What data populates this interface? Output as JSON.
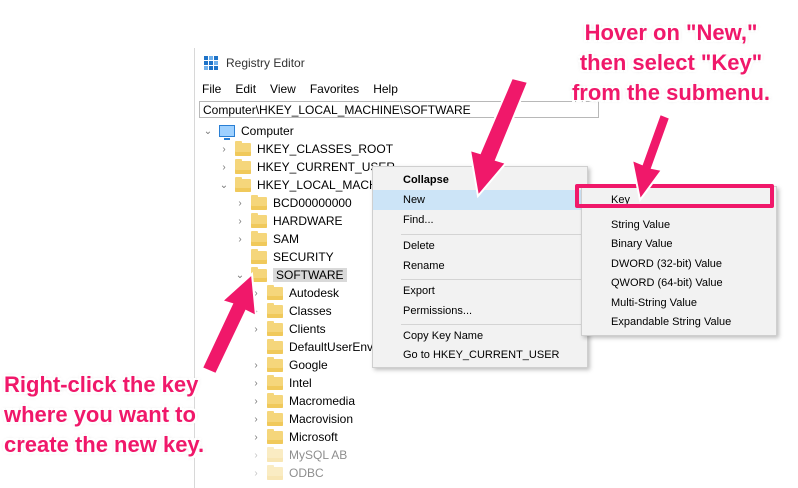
{
  "window": {
    "title": "Registry Editor",
    "menu": [
      "File",
      "Edit",
      "View",
      "Favorites",
      "Help"
    ],
    "address": "Computer\\HKEY_LOCAL_MACHINE\\SOFTWARE"
  },
  "tree": {
    "root": "Computer",
    "hives": [
      "HKEY_CLASSES_ROOT",
      "HKEY_CURRENT_USER",
      "HKEY_LOCAL_MACHIN"
    ],
    "hklm_children": [
      "BCD00000000",
      "HARDWARE",
      "SAM",
      "SECURITY",
      "SOFTWARE"
    ],
    "software_children": [
      "Autodesk",
      "Classes",
      "Clients",
      "DefaultUserEnvir",
      "Google",
      "Intel",
      "Macromedia",
      "Macrovision",
      "Microsoft",
      "MySQL AB",
      "ODBC"
    ]
  },
  "context_menu": {
    "collapse": "Collapse",
    "new": "New",
    "find": "Find...",
    "delete": "Delete",
    "rename": "Rename",
    "export": "Export",
    "permissions": "Permissions...",
    "copy_key_name": "Copy Key Name",
    "goto": "Go to HKEY_CURRENT_USER"
  },
  "submenu": {
    "key": "Key",
    "string_value": "String Value",
    "binary_value": "Binary Value",
    "dword_value": "DWORD (32-bit) Value",
    "qword_value": "QWORD (64-bit) Value",
    "multi_string_value": "Multi-String Value",
    "expandable_string_value": "Expandable String Value"
  },
  "annotations": {
    "top_line1": "Hover on \"New,\"",
    "top_line2": "then select \"Key\"",
    "top_line3": "from the submenu.",
    "bottom_line1": "Right-click the key",
    "bottom_line2": "where you want to",
    "bottom_line3": "create the new key."
  },
  "colors": {
    "annotation": "#f0186a",
    "menu_highlight": "#cce4f7",
    "folder": "#f5d67b"
  }
}
